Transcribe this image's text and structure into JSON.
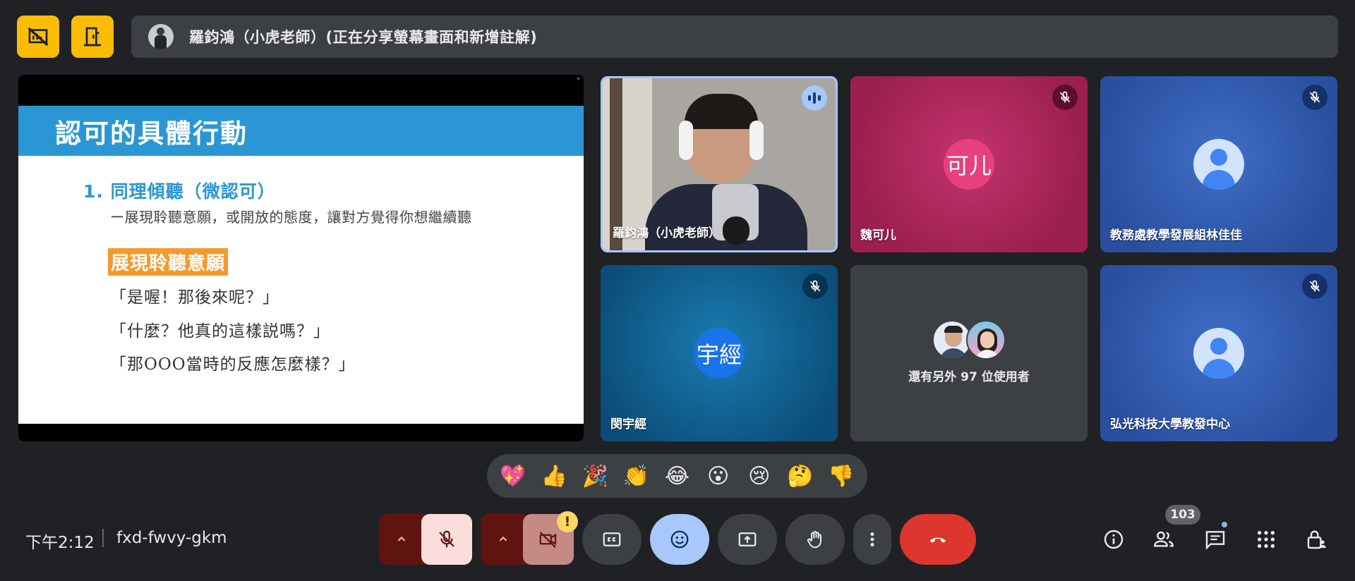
{
  "presenter_banner": {
    "text": "羅鈞鴻（小虎老師）(正在分享螢幕畫面和新增註解)",
    "avatar_icon": "presenter-avatar"
  },
  "top_buttons": [
    {
      "icon": "present-off-icon"
    },
    {
      "icon": "exit-presentation-icon"
    }
  ],
  "slide": {
    "title": "認可的具體行動",
    "subtitle": "1. 同理傾聽（微認可）",
    "description": "ー展現聆聽意願，或開放的態度，讓對方覺得你想繼續聽",
    "highlight": "展現聆聽意願",
    "quotes": [
      "「是喔！那後來呢？」",
      "「什麼？他真的這樣説嗎？」",
      "「那OOO當時的反應怎麼樣？」"
    ],
    "colors": {
      "header": "#2a97d4",
      "highlight": "#f39a2c"
    }
  },
  "participants": [
    {
      "name": "羅鈞鴻（小虎老師）",
      "type": "video",
      "status": "speaking"
    },
    {
      "name": "魏可儿",
      "initials": "可儿",
      "status": "muted",
      "avatar_color": "#e8407a"
    },
    {
      "name": "教務處教學發展組林佳佳",
      "type": "default-avatar",
      "status": "muted"
    },
    {
      "name": "閔宇經",
      "initials": "宇經",
      "status": "muted",
      "avatar_color": "#1a73e8"
    },
    {
      "name": "弘光科技大學教發中心",
      "type": "default-avatar",
      "status": "muted"
    }
  ],
  "others_tile": {
    "text": "還有另外 97 位使用者"
  },
  "reactions": [
    "💖",
    "👍",
    "🎉",
    "👏",
    "😂",
    "😮",
    "😢",
    "🤔",
    "👎"
  ],
  "footer": {
    "time": "下午2:12",
    "meeting_code": "fxd-fwvy-gkm",
    "people_count": "103"
  },
  "controls": [
    {
      "name": "mic-options",
      "icon": "chevron-up-icon"
    },
    {
      "name": "microphone",
      "icon": "mic-off-icon",
      "state": "off"
    },
    {
      "name": "camera-options",
      "icon": "chevron-up-icon"
    },
    {
      "name": "camera",
      "icon": "videocam-off-icon",
      "state": "off"
    },
    {
      "name": "captions",
      "icon": "closed-caption-icon"
    },
    {
      "name": "reactions",
      "icon": "emoji-icon",
      "state": "active"
    },
    {
      "name": "present",
      "icon": "present-screen-icon"
    },
    {
      "name": "raise-hand",
      "icon": "hand-icon"
    },
    {
      "name": "more-options",
      "icon": "more-vert-icon"
    },
    {
      "name": "leave-call",
      "icon": "call-end-icon"
    }
  ],
  "camera_warning_badge": "!",
  "right_controls": [
    {
      "name": "meeting-details",
      "icon": "info-icon"
    },
    {
      "name": "people",
      "icon": "people-icon"
    },
    {
      "name": "chat",
      "icon": "chat-icon"
    },
    {
      "name": "activities",
      "icon": "apps-grid-icon"
    },
    {
      "name": "host-controls",
      "icon": "lock-person-icon"
    }
  ]
}
